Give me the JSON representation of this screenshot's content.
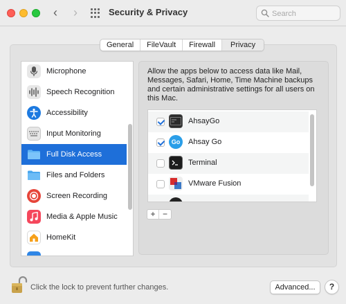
{
  "window": {
    "title": "Security & Privacy"
  },
  "search": {
    "placeholder": "Search",
    "value": ""
  },
  "tabs": [
    {
      "label": "General",
      "active": false
    },
    {
      "label": "FileVault",
      "active": false
    },
    {
      "label": "Firewall",
      "active": false
    },
    {
      "label": "Privacy",
      "active": true
    }
  ],
  "categories": [
    {
      "label": "Microphone",
      "icon": "microphone-icon"
    },
    {
      "label": "Speech Recognition",
      "icon": "waveform-icon"
    },
    {
      "label": "Accessibility",
      "icon": "accessibility-icon"
    },
    {
      "label": "Input Monitoring",
      "icon": "keyboard-icon"
    },
    {
      "label": "Full Disk Access",
      "icon": "folder-icon",
      "selected": true
    },
    {
      "label": "Files and Folders",
      "icon": "folder-icon"
    },
    {
      "label": "Screen Recording",
      "icon": "record-icon"
    },
    {
      "label": "Media & Apple Music",
      "icon": "music-icon"
    },
    {
      "label": "HomeKit",
      "icon": "home-icon"
    }
  ],
  "description": "Allow the apps below to access data like Mail, Messages, Safari, Home, Time Machine backups and certain administrative settings for all users on this Mac.",
  "apps": [
    {
      "label": "AhsayGo",
      "checked": true,
      "icon": "terminal-app-icon"
    },
    {
      "label": "Ahsay Go",
      "checked": true,
      "icon": "ahsay-go-icon"
    },
    {
      "label": "Terminal",
      "checked": false,
      "icon": "terminal-icon"
    },
    {
      "label": "VMware Fusion",
      "checked": false,
      "icon": "vmware-icon"
    }
  ],
  "list_controls": {
    "add": "+",
    "remove": "−"
  },
  "footer": {
    "lock_message": "Click the lock to prevent further changes.",
    "advanced_label": "Advanced...",
    "help_label": "?"
  },
  "colors": {
    "selection": "#1e6fd9",
    "checkbox_check": "#1e6fd9"
  }
}
